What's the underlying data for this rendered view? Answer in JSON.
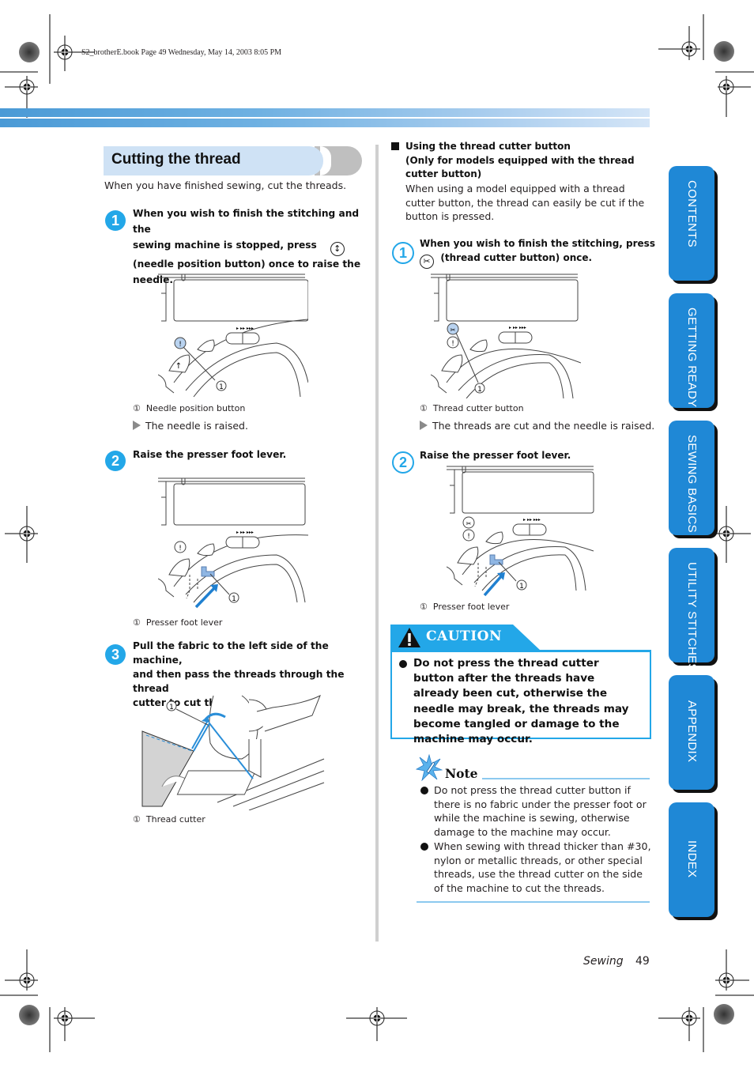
{
  "header": {
    "print_info": "S2_brotherE.book  Page 49  Wednesday, May 14, 2003  8:05 PM"
  },
  "colors": {
    "accent": "#23a7e8",
    "tab": "#1f88d6",
    "title_bg": "#cfe2f5",
    "band_start": "#4a9ad6",
    "band_end": "#d4e5f7"
  },
  "left": {
    "section_title": "Cutting the thread",
    "intro": "When you have finished sewing, cut the threads.",
    "steps": [
      {
        "number": "1",
        "text_lines": [
          "When you wish to finish the stitching and the",
          "sewing machine is stopped, press",
          "(needle position button) once to raise the",
          "needle."
        ],
        "inline_icon": "needle-position-icon",
        "caption": "Needle position button",
        "callout": "①",
        "result": "The needle is raised."
      },
      {
        "number": "2",
        "text": "Raise the presser foot lever.",
        "caption": "Presser foot lever",
        "callout": "①"
      },
      {
        "number": "3",
        "text_lines": [
          "Pull the fabric to the left side of the machine,",
          "and then pass the threads through the thread",
          "cutter to cut them."
        ],
        "caption": "Thread cutter",
        "callout": "①"
      }
    ]
  },
  "right": {
    "subsection_title_lines": [
      "Using the thread cutter button",
      "(Only for models equipped with the thread",
      "cutter button)"
    ],
    "subsection_body_lines": [
      "When using a model equipped with a thread",
      "cutter button, the thread can easily be cut if the",
      "button is pressed."
    ],
    "steps": [
      {
        "number": "1",
        "text_line1": "When you wish to finish the stitching, press",
        "text_line2": "(thread cutter button) once.",
        "inline_icon": "thread-cutter-icon",
        "caption": "Thread cutter button",
        "callout": "①",
        "result": "The threads are cut and the needle is raised."
      },
      {
        "number": "2",
        "text": "Raise the presser foot lever.",
        "caption": "Presser foot lever",
        "callout": "①"
      }
    ],
    "caution": {
      "title": "CAUTION",
      "text": "Do not press the thread cutter button after the threads have already been cut, otherwise the needle may break, the threads may become tangled or damage to the machine may occur."
    },
    "note": {
      "title": "Note",
      "items": [
        "Do not press the thread cutter button if there is no fabric under the presser foot or while the machine is sewing, otherwise damage to the machine may occur.",
        "When sewing with thread thicker than #30, nylon or metallic threads, or other special threads, use the thread cutter on the side of the machine to cut the threads."
      ]
    }
  },
  "side_tabs": [
    {
      "label": "CONTENTS"
    },
    {
      "label": "GETTING READY"
    },
    {
      "label": "SEWING BASICS"
    },
    {
      "label": "UTILITY STITCHES"
    },
    {
      "label": "APPENDIX"
    },
    {
      "label": "INDEX"
    }
  ],
  "footer": {
    "section": "Sewing",
    "page_number": "49"
  },
  "speed_marks": "▸  ▸▸  ▸▸▸"
}
